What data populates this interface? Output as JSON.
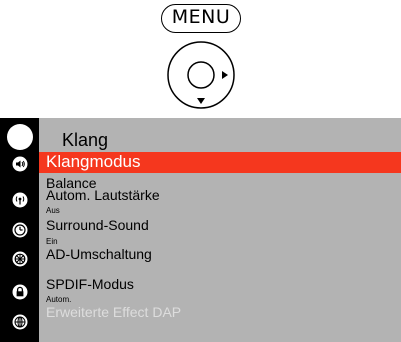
{
  "remote": {
    "menu_key_label": "MENU",
    "nav_pad_icon": "nav-pad-right-down-icon"
  },
  "osd": {
    "title": "Klang",
    "sidebar_icons": [
      "picture-icon",
      "speaker-icon",
      "broadcast-icon",
      "clock-icon",
      "settings-wheel-icon",
      "lock-icon",
      "globe-icon"
    ],
    "items": [
      {
        "label": "Klangmodus",
        "state": "selected"
      },
      {
        "label": "Balance"
      },
      {
        "label": "Autom. Lautstärke",
        "value": "Aus"
      },
      {
        "label": "Surround-Sound",
        "value": "Ein"
      },
      {
        "label": "AD-Umschaltung"
      },
      {
        "label": "SPDIF-Modus",
        "value": "Autom."
      },
      {
        "label": "Erweiterte Effect DAP",
        "state": "disabled"
      }
    ]
  },
  "colors": {
    "menu_background": "#b3b3b3",
    "sidebar": "#000000",
    "highlight": "#f5371e",
    "disabled_text": "#dddddd"
  }
}
